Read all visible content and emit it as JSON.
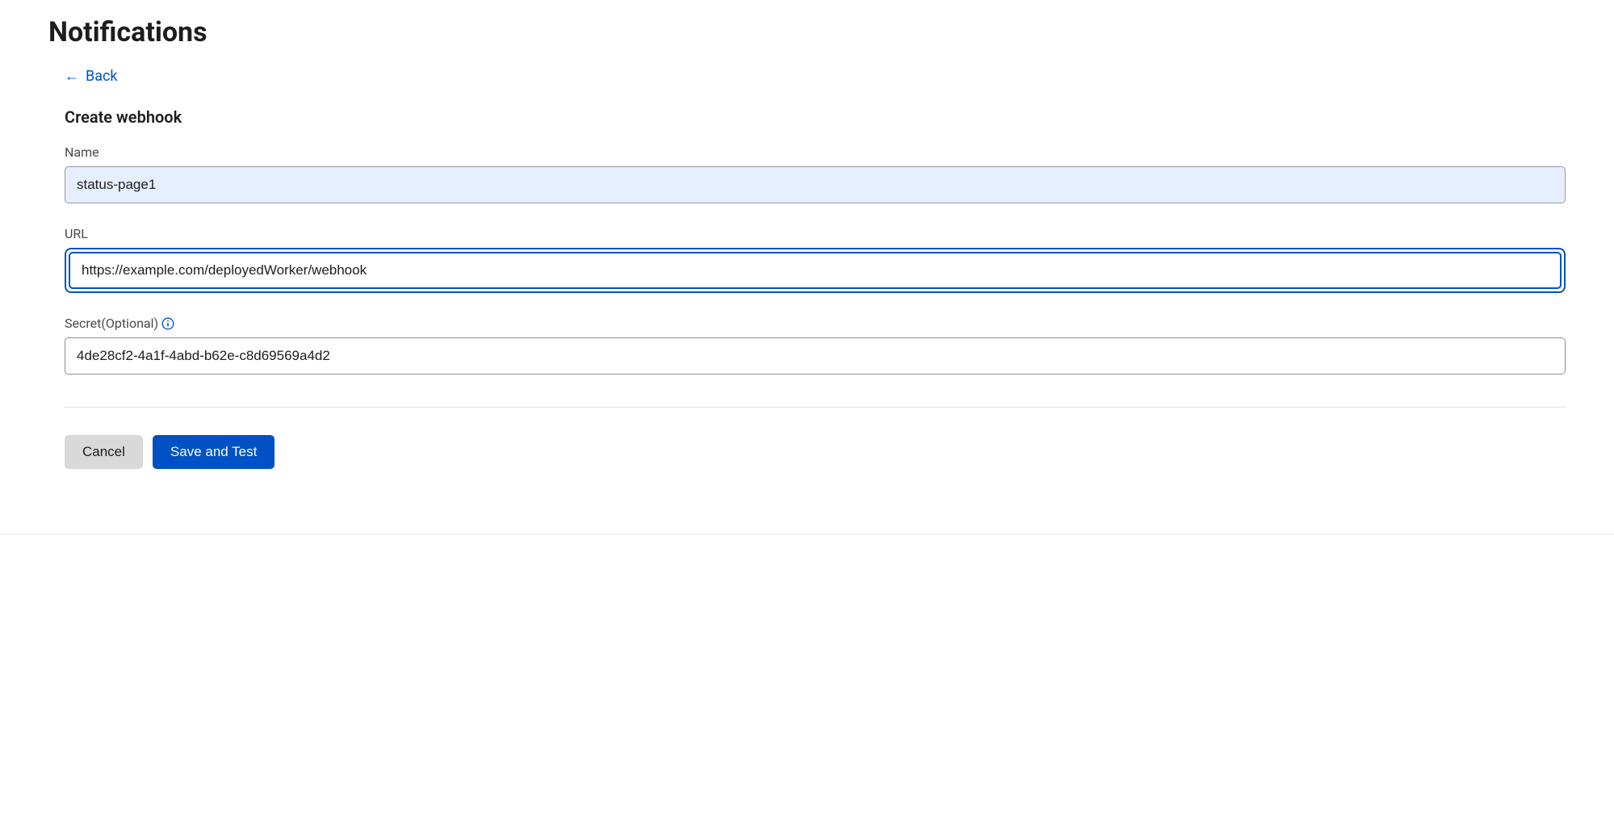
{
  "header": {
    "title": "Notifications",
    "back_label": "Back"
  },
  "form": {
    "section_title": "Create webhook",
    "name": {
      "label": "Name",
      "value": "status-page1"
    },
    "url": {
      "label": "URL",
      "value": "https://example.com/deployedWorker/webhook"
    },
    "secret": {
      "label": "Secret(Optional)",
      "value": "4de28cf2-4a1f-4abd-b62e-c8d69569a4d2"
    }
  },
  "buttons": {
    "cancel": "Cancel",
    "save": "Save and Test"
  }
}
